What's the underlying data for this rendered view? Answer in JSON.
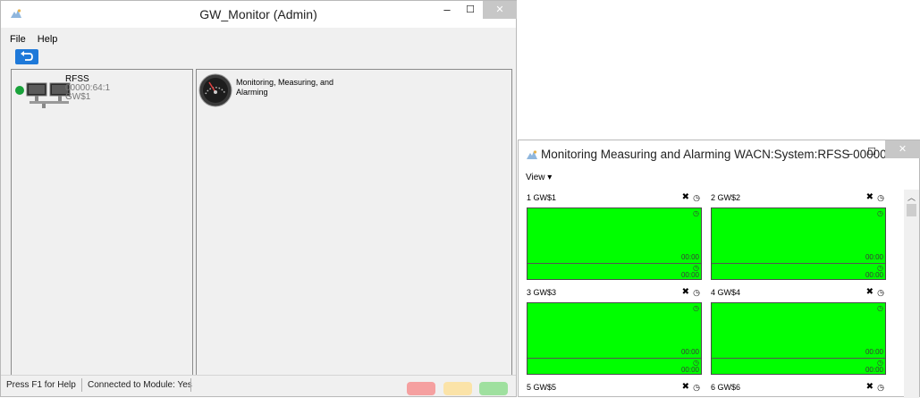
{
  "main_window": {
    "title": "GW_Monitor (Admin)",
    "controls": {
      "minimize": "–",
      "maximize": "☐",
      "close": "✕"
    },
    "menu": [
      "File",
      "Help"
    ],
    "tree": {
      "name": "RFSS",
      "id": "00000:64:1",
      "gateway": "GW$1",
      "status_color": "#19a23a"
    },
    "module": {
      "label": "Monitoring, Measuring, and Alarming"
    },
    "status": {
      "help": "Press F1 for Help",
      "connection": "Connected to Module: Yes"
    },
    "indicators": [
      {
        "name": "red",
        "color": "#f5a0a0"
      },
      {
        "name": "yellow",
        "color": "#fbe3a8"
      },
      {
        "name": "green",
        "color": "#9fe09f"
      }
    ]
  },
  "monitor_window": {
    "title": "Monitoring Measuring and Alarming WACN:System:RFSS 00000:...",
    "controls": {
      "minimize": "–",
      "maximize": "☐",
      "close": "✕"
    },
    "menu": {
      "view": "View ▾"
    },
    "gateways": [
      {
        "label": "1  GW$1",
        "time_top": "00:00",
        "time_bottom": "00:00"
      },
      {
        "label": "2  GW$2",
        "time_top": "00:00",
        "time_bottom": "00:00"
      },
      {
        "label": "3  GW$3",
        "time_top": "00:00",
        "time_bottom": "00:00"
      },
      {
        "label": "4  GW$4",
        "time_top": "00:00",
        "time_bottom": "00:00"
      },
      {
        "label": "5  GW$5"
      },
      {
        "label": "6  GW$6"
      }
    ],
    "panel_color": "#00ff00"
  }
}
